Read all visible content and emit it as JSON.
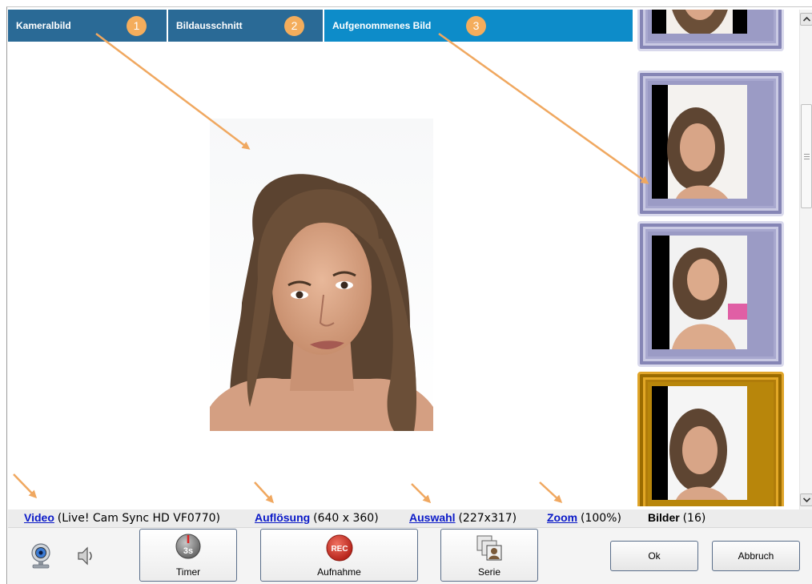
{
  "tabs": [
    {
      "label": "Kameralbild",
      "num": "1"
    },
    {
      "label": "Bildausschnitt",
      "num": "2"
    },
    {
      "label": "Aufgenommenes Bild",
      "num": "3"
    }
  ],
  "colors": {
    "tab_dark": "#2a6a96",
    "tab_active": "#0d8cc9",
    "badge": "#f4ad5c",
    "arrow": "#f0a860",
    "link": "#0b1ac8"
  },
  "thumbnails": [
    {
      "frame": "silver"
    },
    {
      "frame": "silver"
    },
    {
      "frame": "silver"
    },
    {
      "frame": "gold",
      "selected": true
    }
  ],
  "status": {
    "video_link": "Video",
    "video_value": "(Live! Cam Sync HD VF0770)",
    "res_link": "Auflösung",
    "res_value": "(640 x 360)",
    "sel_link": "Auswahl",
    "sel_value": "(227x317)",
    "zoom_link": "Zoom",
    "zoom_value": "(100%)",
    "images_label": "Bilder",
    "images_value": "(16)"
  },
  "toolbar": {
    "webcam_icon": "webcam-icon",
    "speaker_icon": "speaker-icon",
    "timer_badge": "3s",
    "timer_label": "Timer",
    "rec_badge": "REC",
    "record_label": "Aufnahme",
    "series_label": "Serie",
    "ok_label": "Ok",
    "cancel_label": "Abbruch"
  }
}
